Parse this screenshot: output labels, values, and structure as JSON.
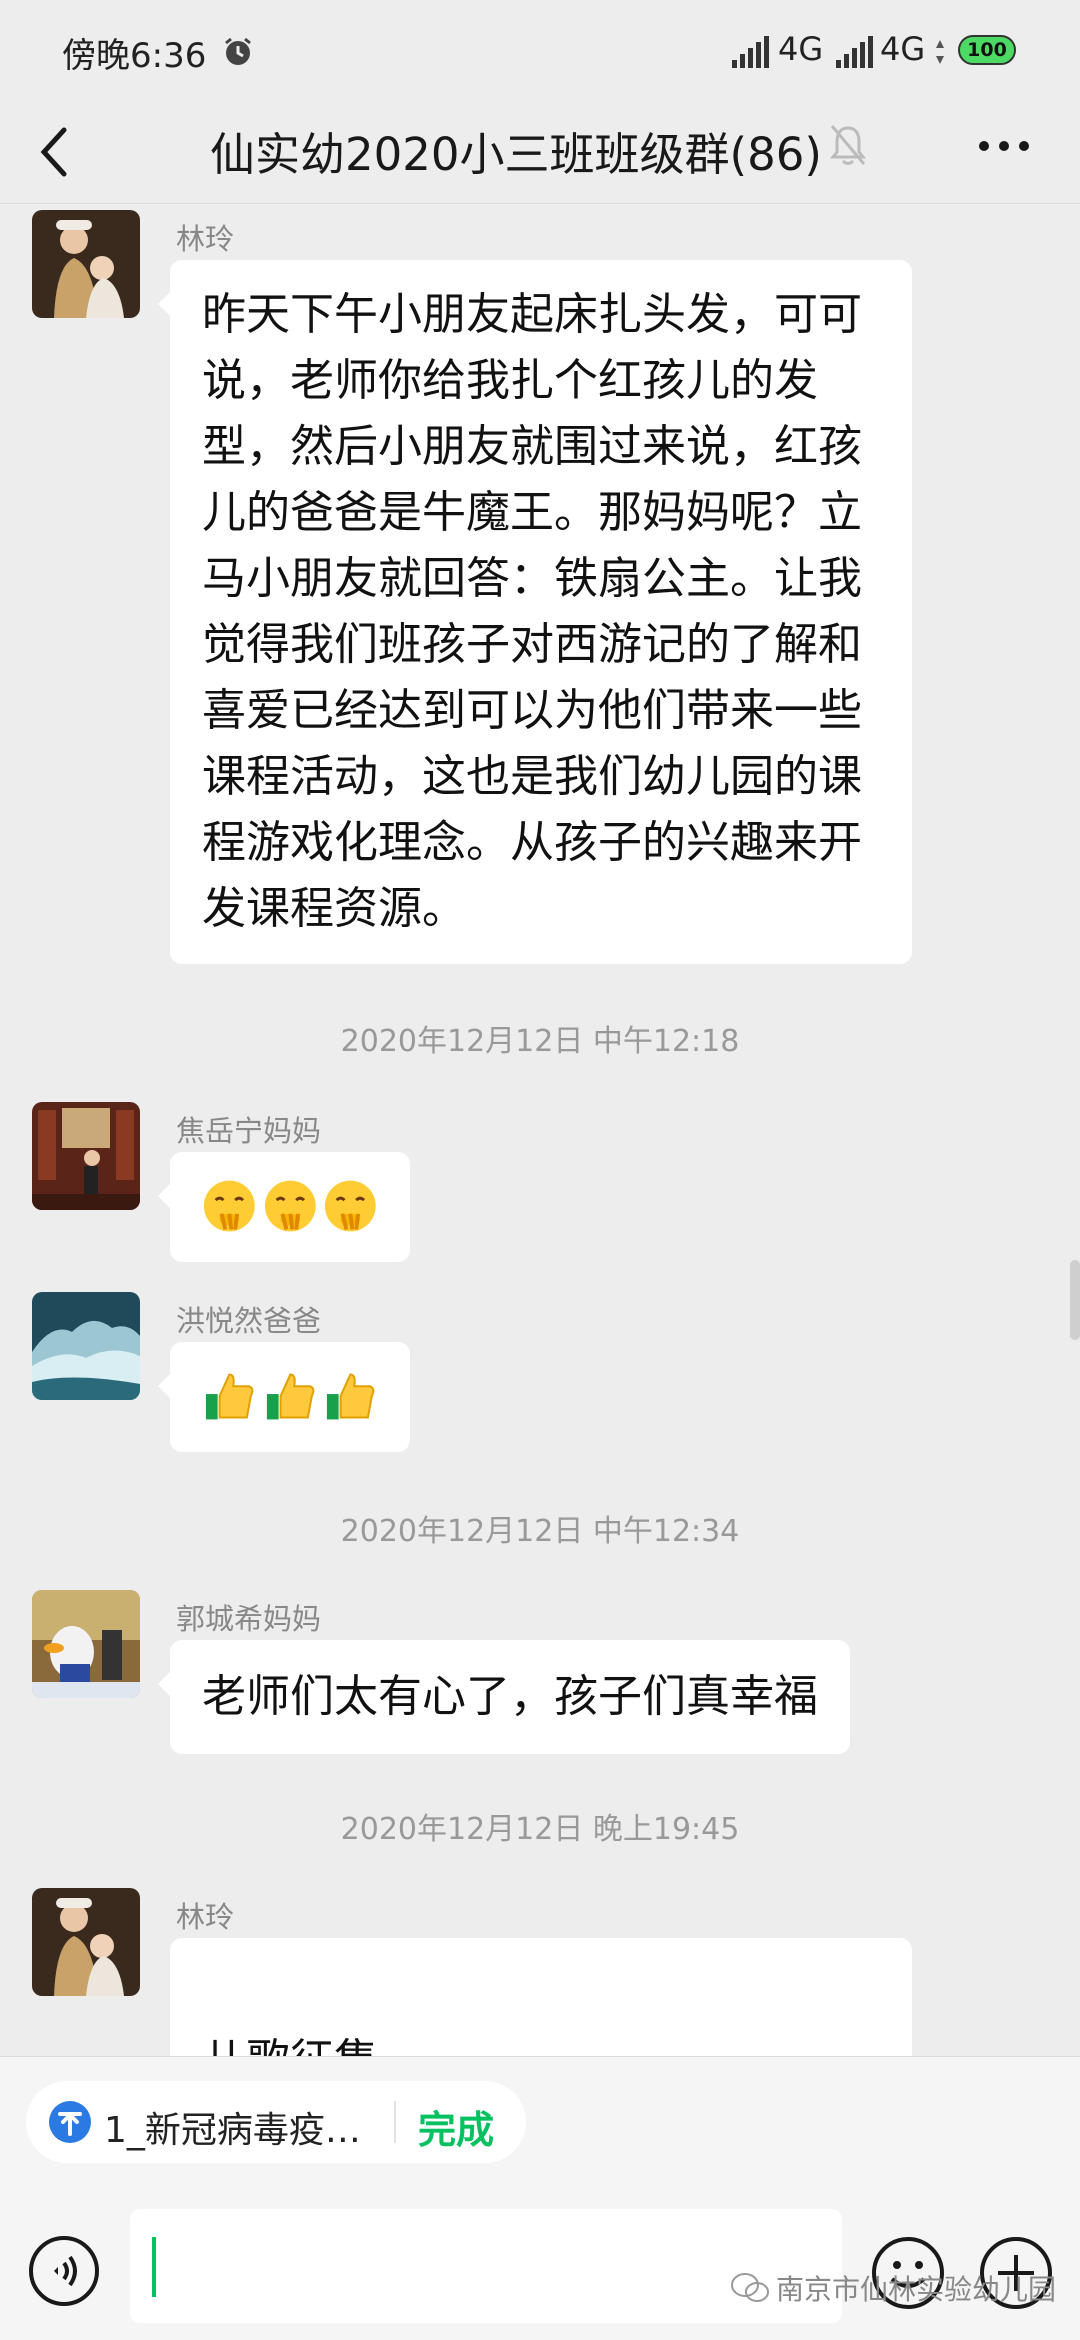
{
  "status_bar": {
    "time": "傍晚6:36",
    "network_1": "4G",
    "network_2": "4G",
    "battery": "100",
    "battery_color": "#4cd964"
  },
  "header": {
    "title": "仙实幼2020小三班班级群(86)",
    "back_icon": "chevron-left-icon",
    "mute_icon": "bell-off-icon",
    "more_icon": "more-dots-icon"
  },
  "messages": [
    {
      "sender": "林玲",
      "text": "昨天下午小朋友起床扎头发，可可说，老师你给我扎个红孩儿的发型，然后小朋友就围过来说，红孩儿的爸爸是牛魔王。那妈妈呢？立马小朋友就回答：铁扇公主。让我觉得我们班孩子对西游记的了解和喜爱已经达到可以为他们带来一些课程活动，这也是我们幼儿园的课程游戏化理念。从孩子的兴趣来开发课程资源。"
    },
    {
      "timestamp": "2020年12月12日 中午12:18"
    },
    {
      "sender": "焦岳宁妈妈",
      "emoji": [
        "shushing-face",
        "shushing-face",
        "shushing-face"
      ]
    },
    {
      "sender": "洪悦然爸爸",
      "emoji": [
        "thumbs-up",
        "thumbs-up",
        "thumbs-up"
      ]
    },
    {
      "timestamp": "2020年12月12日 中午12:34"
    },
    {
      "sender": "郭城希妈妈",
      "text": "老师们太有心了，孩子们真幸福"
    },
    {
      "timestamp": "2020年12月12日 晚上19:45"
    },
    {
      "sender": "林玲",
      "text": "儿歌征集\n《孙悟空打妖怪》这首儿歌我们班"
    }
  ],
  "pinned_bar": {
    "label": "1_新冠病毒疫…",
    "done": "完成",
    "accent": "#07c160"
  },
  "input": {
    "voice_icon": "voice-icon",
    "emoji_icon": "smile-icon",
    "plus_icon": "plus-circle-icon"
  },
  "watermark": "南京市仙林实验幼儿园"
}
